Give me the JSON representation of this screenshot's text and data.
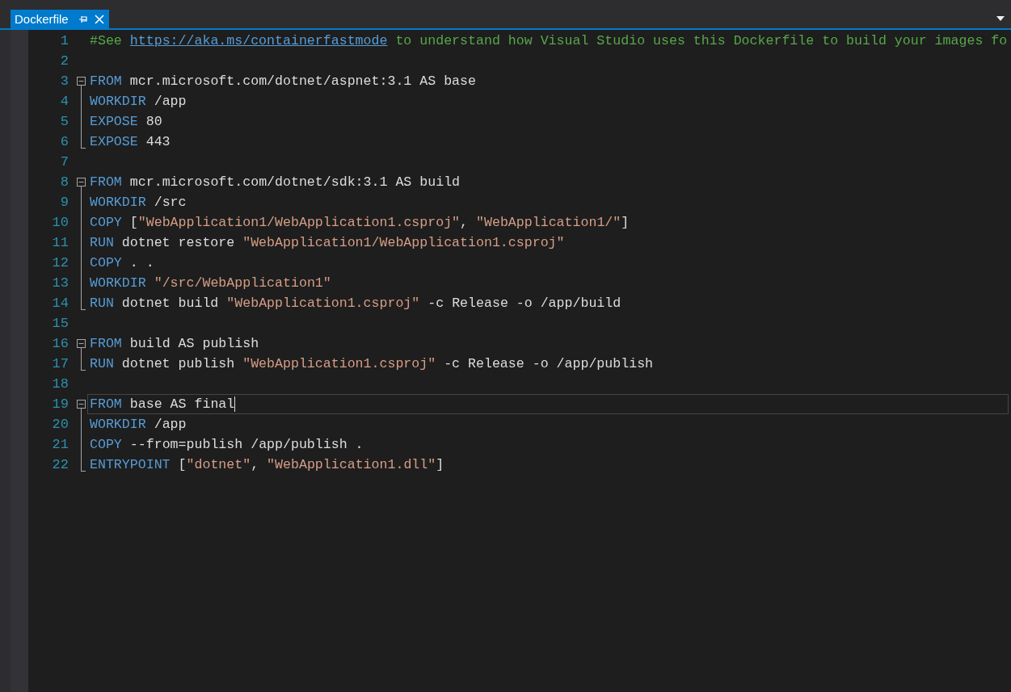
{
  "tabs": [
    {
      "title": "Dockerfile",
      "selected": true,
      "pinned": false
    }
  ],
  "lines": [
    {
      "number": "1",
      "fold_start": false,
      "fold_body": false,
      "fold_end": false,
      "current": false,
      "tokens": [
        {
          "kind": "comment",
          "text": "#See "
        },
        {
          "kind": "link",
          "text": "https://aka.ms/containerfastmode"
        },
        {
          "kind": "comment",
          "text": " to understand how Visual Studio uses this Dockerfile to build your images fo"
        }
      ]
    },
    {
      "number": "2",
      "fold_start": false,
      "fold_body": false,
      "fold_end": false,
      "current": false
    },
    {
      "number": "3",
      "fold_start": true,
      "fold_body": false,
      "fold_end": false,
      "current": false,
      "tokens": [
        {
          "kind": "keyword",
          "text": "FROM"
        },
        {
          "kind": "plain",
          "text": " mcr.microsoft.com/dotnet/aspnet:3.1 AS base"
        }
      ]
    },
    {
      "number": "4",
      "fold_start": false,
      "fold_body": true,
      "fold_end": false,
      "current": false,
      "tokens": [
        {
          "kind": "keyword",
          "text": "WORKDIR"
        },
        {
          "kind": "plain",
          "text": " /app"
        }
      ]
    },
    {
      "number": "5",
      "fold_start": false,
      "fold_body": true,
      "fold_end": false,
      "current": false,
      "tokens": [
        {
          "kind": "keyword",
          "text": "EXPOSE"
        },
        {
          "kind": "plain",
          "text": " 80"
        }
      ]
    },
    {
      "number": "6",
      "fold_start": false,
      "fold_body": false,
      "fold_end": true,
      "current": false,
      "tokens": [
        {
          "kind": "keyword",
          "text": "EXPOSE"
        },
        {
          "kind": "plain",
          "text": " 443"
        }
      ]
    },
    {
      "number": "7",
      "fold_start": false,
      "fold_body": false,
      "fold_end": false,
      "current": false
    },
    {
      "number": "8",
      "fold_start": true,
      "fold_body": false,
      "fold_end": false,
      "current": false,
      "tokens": [
        {
          "kind": "keyword",
          "text": "FROM"
        },
        {
          "kind": "plain",
          "text": " mcr.microsoft.com/dotnet/sdk:3.1 AS build"
        }
      ]
    },
    {
      "number": "9",
      "fold_start": false,
      "fold_body": true,
      "fold_end": false,
      "current": false,
      "tokens": [
        {
          "kind": "keyword",
          "text": "WORKDIR"
        },
        {
          "kind": "plain",
          "text": " /src"
        }
      ]
    },
    {
      "number": "10",
      "fold_start": false,
      "fold_body": true,
      "fold_end": false,
      "current": false,
      "tokens": [
        {
          "kind": "keyword",
          "text": "COPY"
        },
        {
          "kind": "plain",
          "text": " ["
        },
        {
          "kind": "string",
          "text": "\"WebApplication1/WebApplication1.csproj\""
        },
        {
          "kind": "plain",
          "text": ", "
        },
        {
          "kind": "string",
          "text": "\"WebApplication1/\""
        },
        {
          "kind": "plain",
          "text": "]"
        }
      ]
    },
    {
      "number": "11",
      "fold_start": false,
      "fold_body": true,
      "fold_end": false,
      "current": false,
      "tokens": [
        {
          "kind": "keyword",
          "text": "RUN"
        },
        {
          "kind": "plain",
          "text": " dotnet restore "
        },
        {
          "kind": "string",
          "text": "\"WebApplication1/WebApplication1.csproj\""
        }
      ]
    },
    {
      "number": "12",
      "fold_start": false,
      "fold_body": true,
      "fold_end": false,
      "current": false,
      "tokens": [
        {
          "kind": "keyword",
          "text": "COPY"
        },
        {
          "kind": "plain",
          "text": " . ."
        }
      ]
    },
    {
      "number": "13",
      "fold_start": false,
      "fold_body": true,
      "fold_end": false,
      "current": false,
      "tokens": [
        {
          "kind": "keyword",
          "text": "WORKDIR"
        },
        {
          "kind": "string",
          "text": " \"/src/WebApplication1\""
        }
      ]
    },
    {
      "number": "14",
      "fold_start": false,
      "fold_body": false,
      "fold_end": true,
      "current": false,
      "tokens": [
        {
          "kind": "keyword",
          "text": "RUN"
        },
        {
          "kind": "plain",
          "text": " dotnet build "
        },
        {
          "kind": "string",
          "text": "\"WebApplication1.csproj\""
        },
        {
          "kind": "plain",
          "text": " -c Release -o /app/build"
        }
      ]
    },
    {
      "number": "15",
      "fold_start": false,
      "fold_body": false,
      "fold_end": false,
      "current": false
    },
    {
      "number": "16",
      "fold_start": true,
      "fold_body": false,
      "fold_end": false,
      "current": false,
      "tokens": [
        {
          "kind": "keyword",
          "text": "FROM"
        },
        {
          "kind": "plain",
          "text": " build AS publish"
        }
      ]
    },
    {
      "number": "17",
      "fold_start": false,
      "fold_body": false,
      "fold_end": true,
      "current": false,
      "tokens": [
        {
          "kind": "keyword",
          "text": "RUN"
        },
        {
          "kind": "plain",
          "text": " dotnet publish "
        },
        {
          "kind": "string",
          "text": "\"WebApplication1.csproj\""
        },
        {
          "kind": "plain",
          "text": " -c Release -o /app/publish"
        }
      ]
    },
    {
      "number": "18",
      "fold_start": false,
      "fold_body": false,
      "fold_end": false,
      "current": false
    },
    {
      "number": "19",
      "fold_start": true,
      "fold_body": false,
      "fold_end": false,
      "current": true,
      "tokens": [
        {
          "kind": "keyword",
          "text": "FROM"
        },
        {
          "kind": "plain",
          "text": " base AS final"
        }
      ]
    },
    {
      "number": "20",
      "fold_start": false,
      "fold_body": true,
      "fold_end": false,
      "current": false,
      "tokens": [
        {
          "kind": "keyword",
          "text": "WORKDIR"
        },
        {
          "kind": "plain",
          "text": " /app"
        }
      ]
    },
    {
      "number": "21",
      "fold_start": false,
      "fold_body": true,
      "fold_end": false,
      "current": false,
      "tokens": [
        {
          "kind": "keyword",
          "text": "COPY"
        },
        {
          "kind": "plain",
          "text": " --from=publish /app/publish ."
        }
      ]
    },
    {
      "number": "22",
      "fold_start": false,
      "fold_body": false,
      "fold_end": true,
      "current": false,
      "tokens": [
        {
          "kind": "keyword",
          "text": "ENTRYPOINT"
        },
        {
          "kind": "plain",
          "text": " ["
        },
        {
          "kind": "string",
          "text": "\"dotnet\""
        },
        {
          "kind": "plain",
          "text": ", "
        },
        {
          "kind": "string",
          "text": "\"WebApplication1.dll\""
        },
        {
          "kind": "plain",
          "text": "]"
        }
      ]
    }
  ]
}
